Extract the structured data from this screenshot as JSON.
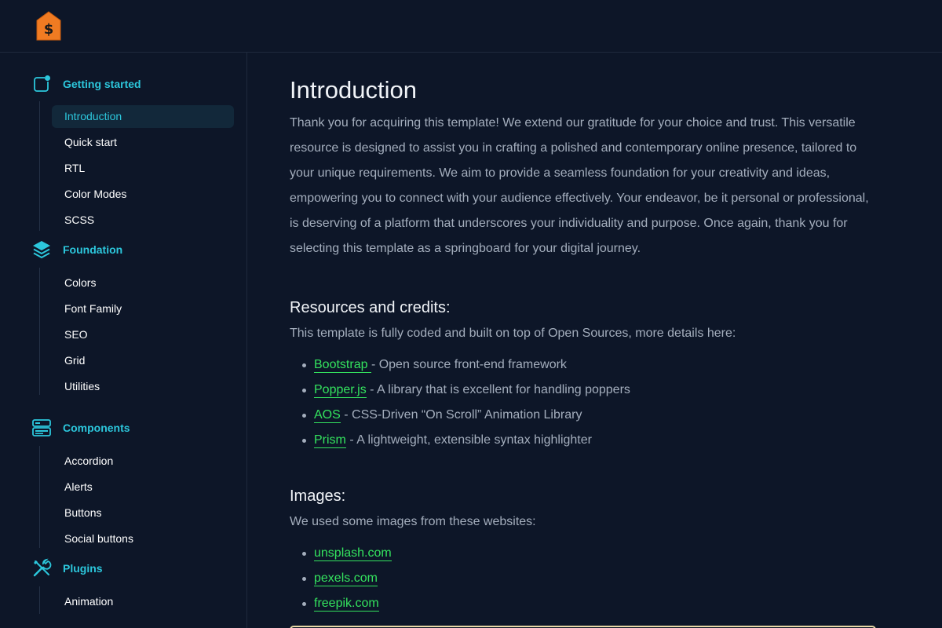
{
  "brand": {
    "logo_icon": "price-tag-dollar-icon",
    "logo_color": "#f07b22"
  },
  "colors": {
    "accent": "#2cc7dc",
    "link": "#34e35e",
    "background": "#0d1628",
    "text_muted": "#a4aebd"
  },
  "sidebar": {
    "groups": [
      {
        "title": "Getting started",
        "icon": "getting-started-icon",
        "items": [
          {
            "label": "Introduction",
            "active": true
          },
          {
            "label": "Quick start"
          },
          {
            "label": "RTL"
          },
          {
            "label": "Color Modes"
          },
          {
            "label": "SCSS"
          }
        ]
      },
      {
        "title": "Foundation",
        "icon": "layers-icon",
        "items": [
          {
            "label": "Colors"
          },
          {
            "label": "Font Family"
          },
          {
            "label": "SEO"
          },
          {
            "label": "Grid"
          },
          {
            "label": "Utilities"
          }
        ]
      },
      {
        "title": "Components",
        "icon": "components-icon",
        "items": [
          {
            "label": "Accordion"
          },
          {
            "label": "Alerts"
          },
          {
            "label": "Buttons"
          },
          {
            "label": "Social buttons"
          }
        ]
      },
      {
        "title": "Plugins",
        "icon": "tools-icon",
        "items": [
          {
            "label": "Animation"
          }
        ]
      }
    ]
  },
  "main": {
    "title": "Introduction",
    "intro": "Thank you for acquiring this template! We extend our gratitude for your choice and trust. This versatile resource is designed to assist you in crafting a polished and contemporary online presence, tailored to your unique requirements. We aim to provide a seamless foundation for your creativity and ideas, empowering you to connect with your audience effectively. Your endeavor, be it personal or professional, is deserving of a platform that underscores your individuality and purpose. Once again, thank you for selecting this template as a springboard for your digital journey.",
    "resources": {
      "heading": "Resources and credits:",
      "description": "This template is fully coded and built on top of Open Sources, more details here:",
      "items": [
        {
          "link": "Bootstrap ",
          "text": " - Open source front-end framework"
        },
        {
          "link": "Popper.js",
          "text": " - A library that is excellent for handling poppers"
        },
        {
          "link": "AOS",
          "text": " - CSS-Driven “On Scroll” Animation Library"
        },
        {
          "link": "Prism",
          "text": " - A lightweight, extensible syntax highlighter"
        }
      ]
    },
    "images": {
      "heading": "Images:",
      "description": "We used some images from these websites:",
      "items": [
        {
          "link": "unsplash.com"
        },
        {
          "link": "pexels.com"
        },
        {
          "link": "freepik.com"
        }
      ]
    }
  }
}
